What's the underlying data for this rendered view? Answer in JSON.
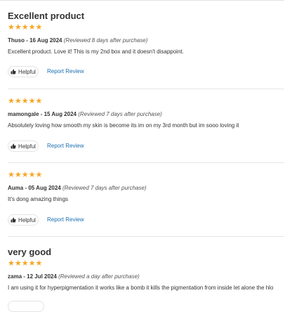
{
  "reviews": [
    {
      "title": "Excellent product",
      "rating": "★★★★★",
      "author": "Thuso",
      "date": "16 Aug 2024",
      "note": "(Reviewed 8 days after purchase)",
      "body": "Excellent product. Love it! This is my 2nd box and it doesn't disappoint.",
      "helpful_label": "Helpful",
      "report_label": "Report Review"
    },
    {
      "title": "",
      "rating": "★★★★★",
      "author": "mamongale",
      "date": "15 Aug 2024",
      "note": "(Reviewed 7 days after purchase)",
      "body": "Absolutely loving how smooth my skin is become its im on my 3rd month but im sooo loving it",
      "helpful_label": "Helpful",
      "report_label": "Report Review"
    },
    {
      "title": "",
      "rating": "★★★★★",
      "author": "Auma",
      "date": "05 Aug 2024",
      "note": "(Reviewed 7 days after purchase)",
      "body": "It's dong amazing things",
      "helpful_label": "Helpful",
      "report_label": "Report Review"
    },
    {
      "title": "very good",
      "rating": "★★★★★",
      "author": "zama",
      "date": "12 Jul 2024",
      "note": "(Reviewed a day after purchase)",
      "body": "I am using it for hyperpigmentation it works like a bomb it kills the pigmentation from inside let alone the hlo"
    }
  ],
  "separator": " - ",
  "colors": {
    "star": "#f5a623",
    "link": "#1a6fb3",
    "border": "#e6e6e6"
  },
  "icons": {
    "helpful": "thumbs-up-icon"
  }
}
